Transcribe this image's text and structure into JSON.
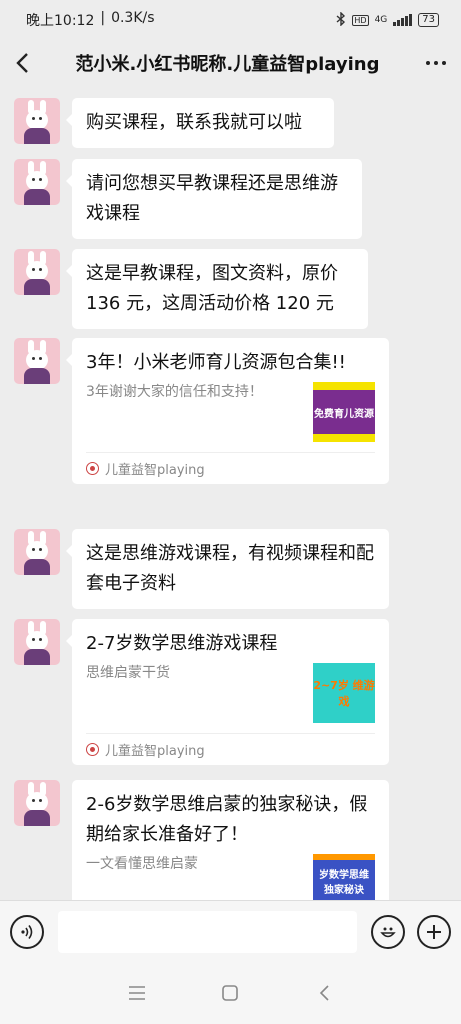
{
  "status": {
    "time": "晚上10:12",
    "speed": "0.3K/s",
    "network": "4G",
    "battery": "73"
  },
  "header": {
    "title": "范小米.小红书昵称.儿童益智playing"
  },
  "messages": [
    {
      "text": "购买课程，联系我就可以啦"
    },
    {
      "text": "请问您想买早教课程还是思维游戏课程"
    },
    {
      "text": "这是早教课程，图文资料，原价136 元，这周活动价格 120 元"
    },
    {
      "title": "3年！小米老师育儿资源包合集!!",
      "desc": "3年谢谢大家的信任和支持！",
      "thumb_text": "免费育儿资源",
      "source": "儿童益智playing"
    },
    {
      "text": "这是思维游戏课程，有视频课程和配套电子资料"
    },
    {
      "title": "2-7岁数学思维游戏课程",
      "desc": "思维启蒙干货",
      "thumb_text": "2~7岁 维游戏",
      "source": "儿童益智playing"
    },
    {
      "title": "2-6岁数学思维启蒙的独家秘诀，假期给家长准备好了！",
      "desc": "一文看懂思维启蒙",
      "thumb_text": "岁数学思维 独家秘诀"
    }
  ],
  "colors": {
    "background": "#ededed",
    "bubble": "#ffffff",
    "thumb1_bg": "#7a2d8f",
    "thumb1_accent": "#f5e300",
    "thumb2_bg": "#2fd0c8",
    "thumb2_accent": "#ff7a00",
    "thumb3_bg": "#3a52c4"
  }
}
